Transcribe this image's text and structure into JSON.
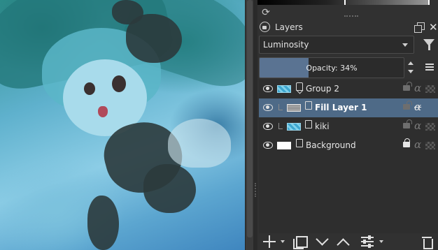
{
  "panel": {
    "title": "Layers",
    "close_glyph": "✕",
    "blend_mode": "Luminosity",
    "opacity_label": "Opacity:  34%",
    "opacity_value": 0.34
  },
  "layers": [
    {
      "name": "Group 2",
      "type": "group",
      "selected": false,
      "visible": true,
      "thumbnail": "blue"
    },
    {
      "name": "Fill Layer 1",
      "type": "fill",
      "selected": true,
      "visible": true,
      "thumbnail": "noise"
    },
    {
      "name": "kiki",
      "type": "paint",
      "selected": false,
      "visible": true,
      "thumbnail": "blue"
    },
    {
      "name": "Background",
      "type": "paint",
      "selected": false,
      "visible": true,
      "thumbnail": "white"
    }
  ],
  "icons": {
    "refresh": "refresh-icon",
    "dock_lock": "lock-icon",
    "float": "float-icon",
    "close": "close-icon",
    "filter": "filter-icon",
    "menu": "hamburger-menu-icon",
    "eye": "eye-icon",
    "lock": "lock-icon",
    "alpha": "alpha-lock-icon",
    "inherit_alpha": "checkerboard-icon",
    "add": "plus-icon",
    "duplicate": "duplicate-icon",
    "move_down": "chevron-down-icon",
    "move_up": "chevron-up-icon",
    "properties": "sliders-icon",
    "delete": "trash-icon"
  },
  "colors": {
    "selection": "#4e6a87",
    "opacity_fill": "#5a7392",
    "panel_bg": "#313131"
  }
}
